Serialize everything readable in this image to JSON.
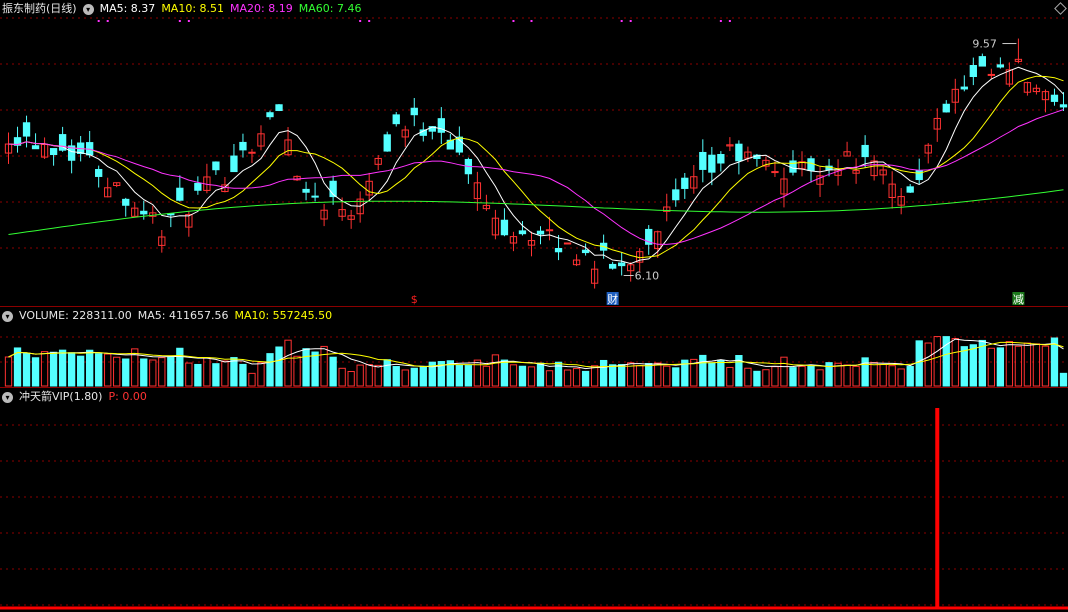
{
  "price_pane": {
    "legend": {
      "title": "振东制药(日线)",
      "items": [
        {
          "text": "MA5: 8.37",
          "color": "#ffffff"
        },
        {
          "text": "MA10: 8.51",
          "color": "#ffff00"
        },
        {
          "text": "MA20: 8.19",
          "color": "#ff33ff"
        },
        {
          "text": "MA60: 7.46",
          "color": "#33ff33"
        }
      ]
    },
    "high_label": "9.57",
    "low_label": "6.10",
    "markers": [
      {
        "text": "$",
        "color": "#ff2020"
      },
      {
        "text": "财",
        "color": "#ffffff",
        "bg": "#1f5fbf"
      },
      {
        "text": "减",
        "color": "#ffffff",
        "bg": "#1c7a1c"
      }
    ]
  },
  "volume_pane": {
    "legend": {
      "items": [
        {
          "text": "VOLUME: 228311.00",
          "color": "#e6e6e6"
        },
        {
          "text": "MA5: 411657.56",
          "color": "#e6e6e6"
        },
        {
          "text": "MA10: 557245.50",
          "color": "#ffff00"
        }
      ]
    }
  },
  "indicator_pane": {
    "legend": {
      "title": "冲天箭VIP(1.80)",
      "items": [
        {
          "text": "P: 0.00",
          "color": "#ff3333"
        }
      ]
    }
  },
  "colors": {
    "up": "#ff3232",
    "down": "#54ffff",
    "ma5": "#ffffff",
    "ma10": "#ffff00",
    "ma20": "#ff33ff",
    "ma60": "#33ff33",
    "grid": "#8b0000",
    "signal": "#ff0000"
  },
  "chart_data": {
    "type": "candlestick",
    "days": 118,
    "price_range": [
      5.8,
      9.9
    ],
    "visible_high": 9.57,
    "visible_low": 6.1,
    "ma5_last": 8.37,
    "ma10_last": 8.51,
    "ma20_last": 8.19,
    "ma60_last": 7.46,
    "ohlc_keypoints": [
      {
        "i": 0,
        "o": 8.3,
        "c": 8.2
      },
      {
        "i": 8,
        "o": 8.0,
        "c": 7.9
      },
      {
        "i": 17,
        "o": 7.5,
        "c": 6.8
      },
      {
        "i": 24,
        "o": 7.4,
        "c": 7.6
      },
      {
        "i": 30,
        "o": 8.0,
        "c": 8.5
      },
      {
        "i": 33,
        "o": 7.6,
        "c": 7.3
      },
      {
        "i": 38,
        "o": 7.2,
        "c": 7.1
      },
      {
        "i": 43,
        "o": 8.1,
        "c": 8.3
      },
      {
        "i": 48,
        "o": 8.5,
        "c": 8.3
      },
      {
        "i": 54,
        "o": 7.0,
        "c": 6.9
      },
      {
        "i": 60,
        "o": 6.7,
        "c": 6.6
      },
      {
        "i": 68,
        "o": 6.4,
        "c": 6.2
      },
      {
        "i": 73,
        "o": 6.8,
        "c": 7.0
      },
      {
        "i": 80,
        "o": 8.0,
        "c": 7.9
      },
      {
        "i": 86,
        "o": 7.6,
        "c": 7.6
      },
      {
        "i": 94,
        "o": 7.7,
        "c": 7.8
      },
      {
        "i": 100,
        "o": 7.4,
        "c": 7.3
      },
      {
        "i": 104,
        "o": 8.3,
        "c": 8.6
      },
      {
        "i": 108,
        "o": 8.8,
        "c": 9.0
      },
      {
        "i": 112,
        "o": 9.4,
        "c": 9.1
      },
      {
        "i": 117,
        "o": 8.5,
        "c": 8.4
      }
    ],
    "marker_days": [
      45,
      67,
      112
    ],
    "volume_range": [
      0,
      1100000
    ],
    "volume_last": 228311,
    "volume_ma5_last": 411657.56,
    "volume_ma10_last": 557245.5,
    "indicator": {
      "name": "冲天箭VIP",
      "param": 1.8,
      "P": 0.0,
      "spike_day": 103
    }
  }
}
